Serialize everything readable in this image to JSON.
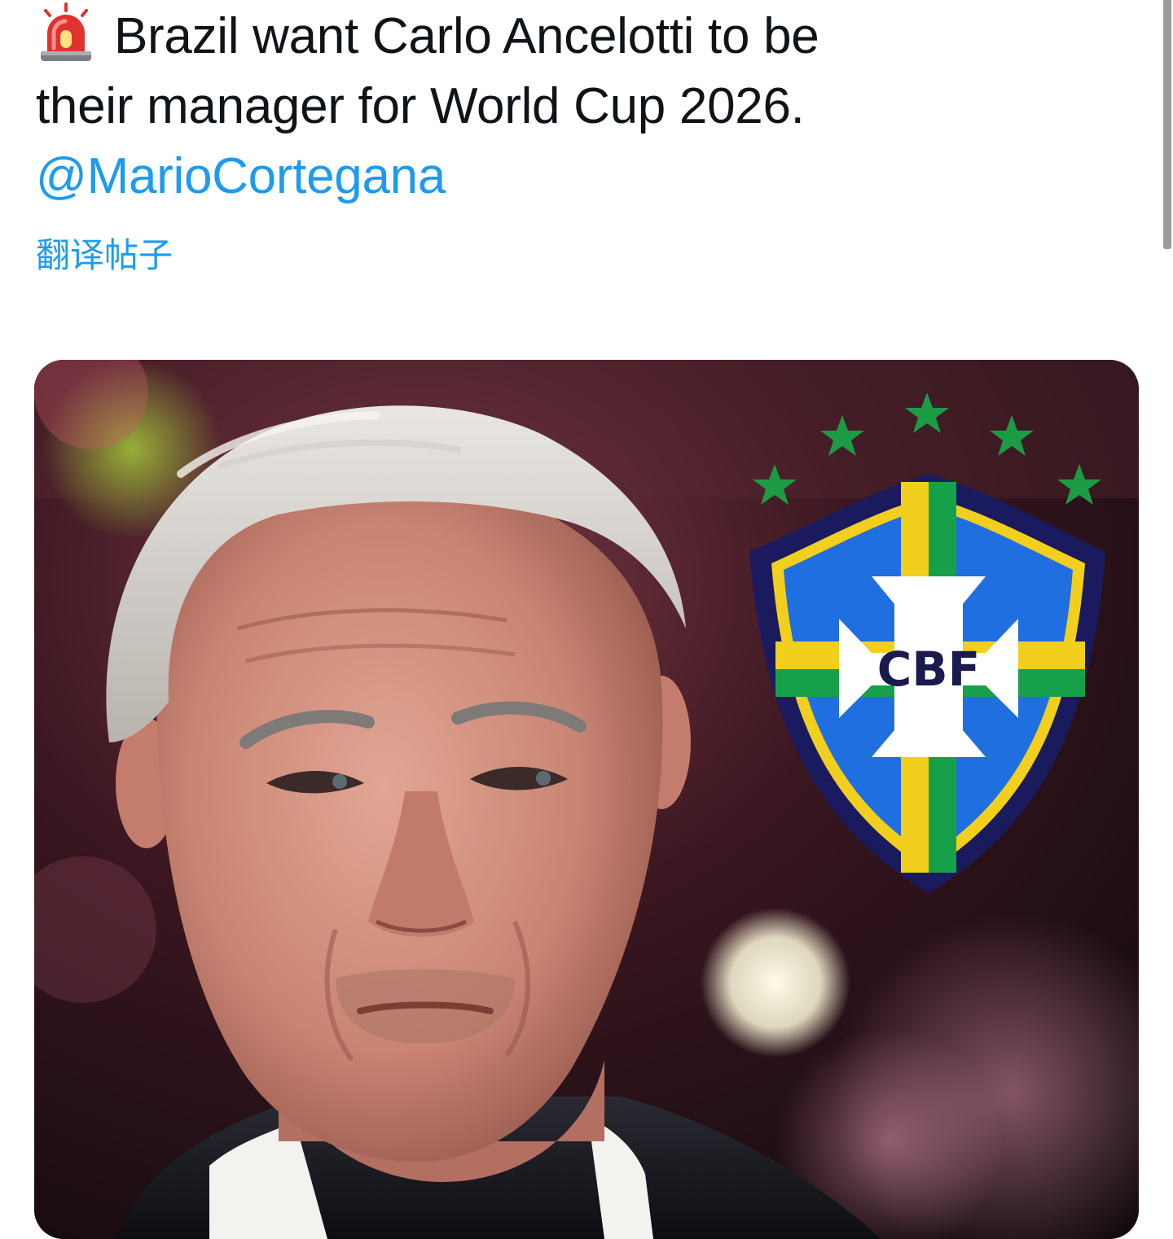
{
  "tweet": {
    "icon": "rotating-light-icon",
    "text_line1": "Brazil want Carlo Ancelotti to be",
    "text_line2": "their manager for World Cup 2026.",
    "mention": "@MarioCortegana",
    "translate_label": "翻译帖子"
  },
  "media": {
    "crest_label": "CBF",
    "crest_stars": 5,
    "colors": {
      "link": "#1d9bf0",
      "crest_blue": "#1f6fe0",
      "crest_navy": "#1a1a5e",
      "crest_yellow": "#f2cf1c",
      "crest_green": "#17a04a",
      "stars": "#1c9b45"
    }
  }
}
